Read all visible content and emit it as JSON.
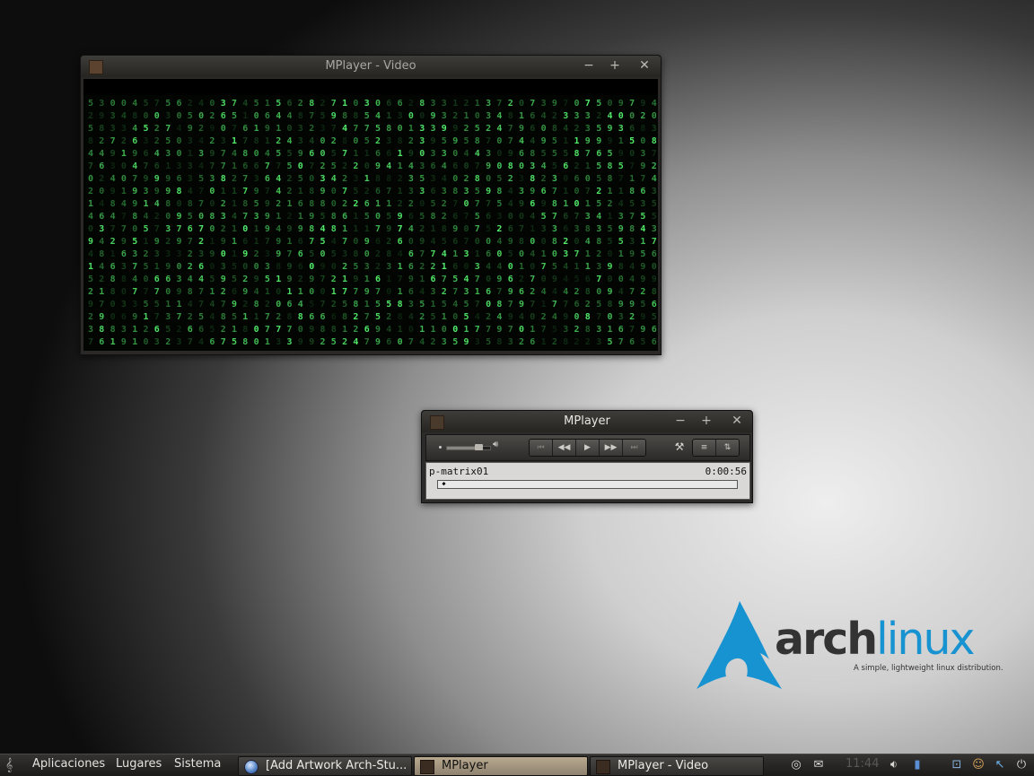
{
  "video_window": {
    "title": "MPlayer - Video",
    "controls": {
      "minimize": "−",
      "maximize": "+",
      "close": "✕"
    }
  },
  "player_window": {
    "title": "MPlayer",
    "controls": {
      "minimize": "−",
      "maximize": "+",
      "close": "✕"
    },
    "volume_level": 0.75,
    "transport": {
      "prev": "⏮",
      "rewind": "◀◀",
      "play": "▶",
      "forward": "▶▶",
      "next": "⏭"
    },
    "tools_icon": "⚒",
    "playlist_icon": "≡",
    "equalizer_icon": "⇅",
    "track_title": "p-matrix01",
    "time": "0:00:56",
    "seek_position": 0.01
  },
  "desktop_logo": {
    "word_bold": "arch",
    "word_light": "linux",
    "tagline": "A simple, lightweight linux distribution."
  },
  "panel": {
    "menus": [
      "Aplicaciones",
      "Lugares",
      "Sistema"
    ],
    "tasks": [
      {
        "label": "[Add Artwork Arch-Stu...",
        "icon": "globe-icon",
        "active": false
      },
      {
        "label": "MPlayer",
        "icon": "mplayer-icon",
        "active": true
      },
      {
        "label": "MPlayer - Video",
        "icon": "mplayer-icon",
        "active": false
      }
    ],
    "clock": "11:44"
  },
  "colors": {
    "arch_blue": "#1793d1",
    "matrix_green": "#3fbf5a",
    "panel_bg": "#262523"
  }
}
